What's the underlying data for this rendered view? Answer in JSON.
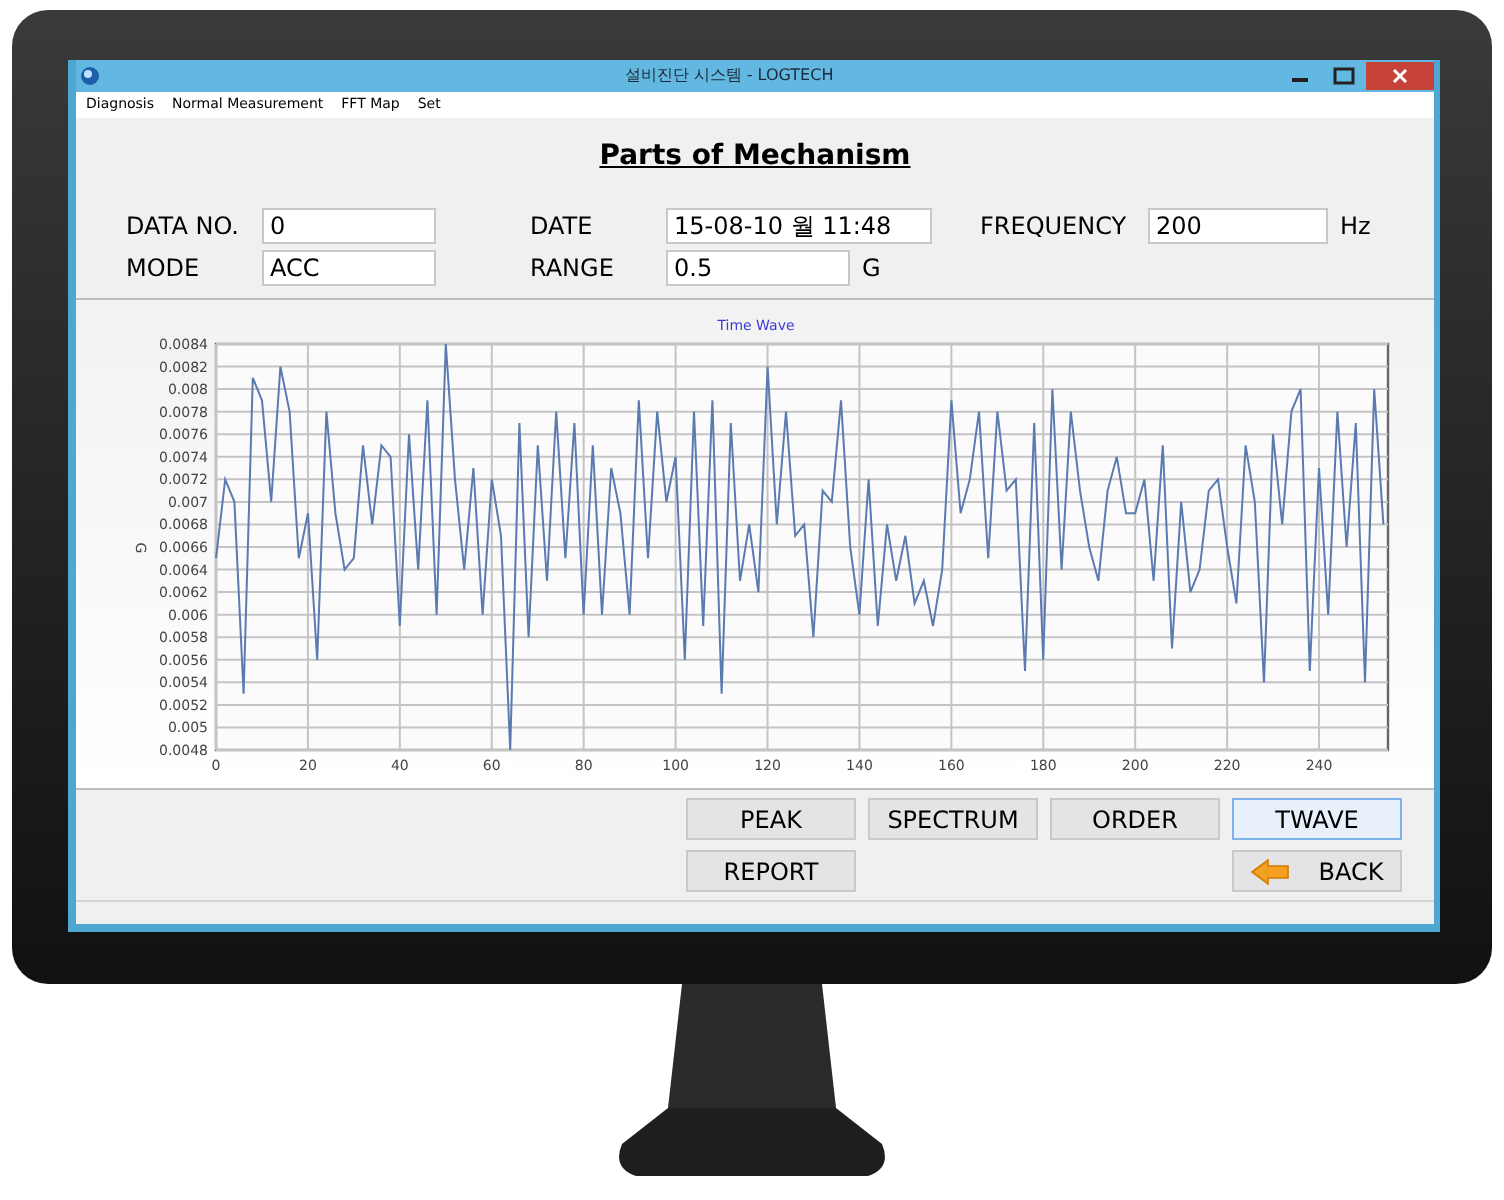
{
  "window": {
    "title": "설비진단 시스템 - LOGTECH"
  },
  "menu": [
    "Diagnosis",
    "Normal Measurement",
    "FFT Map",
    "Set"
  ],
  "heading": "Parts of Mechanism",
  "fields": [
    {
      "label": "DATA NO.",
      "value": "0"
    },
    {
      "label": "DATE",
      "value": "15-08-10 월 11:48"
    },
    {
      "label": "FREQUENCY",
      "value": "200",
      "unit": "Hz"
    },
    {
      "label": "MODE",
      "value": "ACC"
    },
    {
      "label": "RANGE",
      "value": "0.5",
      "unit": "G"
    }
  ],
  "chart": {
    "chart_data": {
      "type": "line",
      "title": "Time Wave",
      "ylabel": "G",
      "xlim": [
        0,
        255
      ],
      "ylim": [
        0.0048,
        0.0084
      ],
      "xticks": [
        0,
        20,
        40,
        60,
        80,
        100,
        120,
        140,
        160,
        180,
        200,
        220,
        240
      ],
      "yticks": [
        {
          "value": 0.0048,
          "label": "0.0048"
        },
        {
          "value": 0.005,
          "label": "0.005"
        },
        {
          "value": 0.0052,
          "label": "0.0052"
        },
        {
          "value": 0.0054,
          "label": "0.0054"
        },
        {
          "value": 0.0056,
          "label": "0.0056"
        },
        {
          "value": 0.0058,
          "label": "0.0058"
        },
        {
          "value": 0.006,
          "label": "0.006"
        },
        {
          "value": 0.0062,
          "label": "0.0062"
        },
        {
          "value": 0.0064,
          "label": "0.0064"
        },
        {
          "value": 0.0066,
          "label": "0.0066"
        },
        {
          "value": 0.0068,
          "label": "0.0068"
        },
        {
          "value": 0.007,
          "label": "0.007"
        },
        {
          "value": 0.0072,
          "label": "0.0072"
        },
        {
          "value": 0.0074,
          "label": "0.0074"
        },
        {
          "value": 0.0076,
          "label": "0.0076"
        },
        {
          "value": 0.0078,
          "label": "0.0078"
        },
        {
          "value": 0.008,
          "label": "0.008"
        },
        {
          "value": 0.0082,
          "label": "0.0082"
        },
        {
          "value": 0.0084,
          "label": "0.0084"
        }
      ],
      "x": [
        0,
        2,
        4,
        6,
        8,
        10,
        12,
        14,
        16,
        18,
        20,
        22,
        24,
        26,
        28,
        30,
        32,
        34,
        36,
        38,
        40,
        42,
        44,
        46,
        48,
        50,
        52,
        54,
        56,
        58,
        60,
        62,
        64,
        66,
        68,
        70,
        72,
        74,
        76,
        78,
        80,
        82,
        84,
        86,
        88,
        90,
        92,
        94,
        96,
        98,
        100,
        102,
        104,
        106,
        108,
        110,
        112,
        114,
        116,
        118,
        120,
        122,
        124,
        126,
        128,
        130,
        132,
        134,
        136,
        138,
        140,
        142,
        144,
        146,
        148,
        150,
        152,
        154,
        156,
        158,
        160,
        162,
        164,
        166,
        168,
        170,
        172,
        174,
        176,
        178,
        180,
        182,
        184,
        186,
        188,
        190,
        192,
        194,
        196,
        198,
        200,
        202,
        204,
        206,
        208,
        210,
        212,
        214,
        216,
        218,
        220,
        222,
        224,
        226,
        228,
        230,
        232,
        234,
        236,
        238,
        240,
        242,
        244,
        246,
        248,
        250,
        252,
        254
      ],
      "grid": true,
      "series": [
        {
          "color": "#5a7bb0",
          "values": [
            0.0065,
            0.0072,
            0.007,
            0.0053,
            0.0081,
            0.0079,
            0.007,
            0.0082,
            0.0078,
            0.0065,
            0.0069,
            0.0056,
            0.0078,
            0.0069,
            0.0064,
            0.0065,
            0.0075,
            0.0068,
            0.0075,
            0.0074,
            0.0059,
            0.0076,
            0.0064,
            0.0079,
            0.006,
            0.0084,
            0.0072,
            0.0064,
            0.0073,
            0.006,
            0.0072,
            0.0067,
            0.0048,
            0.0077,
            0.0058,
            0.0075,
            0.0063,
            0.0078,
            0.0065,
            0.0077,
            0.006,
            0.0075,
            0.006,
            0.0073,
            0.0069,
            0.006,
            0.0079,
            0.0065,
            0.0078,
            0.007,
            0.0074,
            0.0056,
            0.0078,
            0.0059,
            0.0079,
            0.0053,
            0.0077,
            0.0063,
            0.0068,
            0.0062,
            0.0082,
            0.0068,
            0.0078,
            0.0067,
            0.0068,
            0.0058,
            0.0071,
            0.007,
            0.0079,
            0.0066,
            0.006,
            0.0072,
            0.0059,
            0.0068,
            0.0063,
            0.0067,
            0.0061,
            0.0063,
            0.0059,
            0.0064,
            0.0079,
            0.0069,
            0.0072,
            0.0078,
            0.0065,
            0.0078,
            0.0071,
            0.0072,
            0.0055,
            0.0077,
            0.0056,
            0.008,
            0.0064,
            0.0078,
            0.0071,
            0.0066,
            0.0063,
            0.0071,
            0.0074,
            0.0069,
            0.0069,
            0.0072,
            0.0063,
            0.0075,
            0.0057,
            0.007,
            0.0062,
            0.0064,
            0.0071,
            0.0072,
            0.0066,
            0.0061,
            0.0075,
            0.007,
            0.0054,
            0.0076,
            0.0068,
            0.0078,
            0.008,
            0.0055,
            0.0073,
            0.006,
            0.0078,
            0.0066,
            0.0077,
            0.0054,
            0.008,
            0.0068
          ]
        }
      ]
    }
  },
  "buttons": [
    {
      "label": "PEAK",
      "kind": "plain",
      "selected": false
    },
    {
      "label": "SPECTRUM",
      "kind": "plain",
      "selected": false
    },
    {
      "label": "ORDER",
      "kind": "plain",
      "selected": false
    },
    {
      "label": "TWAVE",
      "kind": "plain",
      "selected": true
    },
    {
      "label": "REPORT",
      "kind": "plain",
      "selected": false
    },
    {
      "label": "BACK",
      "kind": "back",
      "selected": false
    }
  ]
}
